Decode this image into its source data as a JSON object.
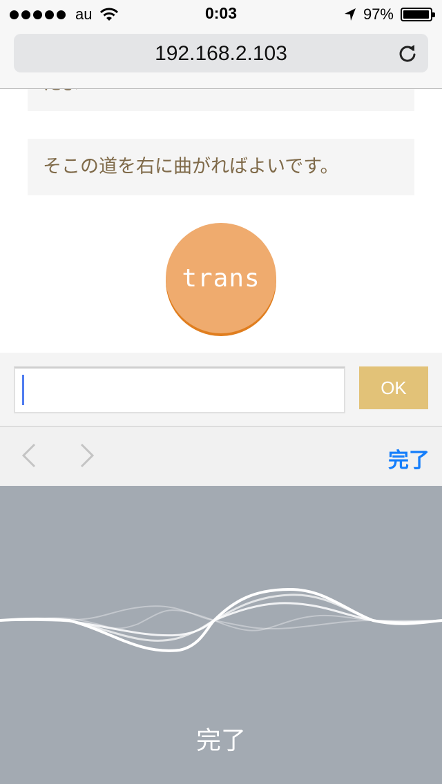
{
  "status_bar": {
    "carrier": "au",
    "time": "0:03",
    "battery_percent_text": "97%",
    "battery_level": 0.97,
    "icons": [
      "signal-dots",
      "wifi-icon",
      "location-arrow-icon",
      "battery-icon"
    ]
  },
  "address_bar": {
    "url": "192.168.2.103",
    "reload_icon": "reload-icon"
  },
  "content": {
    "previous_message": "たよ",
    "message": "そこの道を右に曲がればよいです。",
    "trans_button_label": "trans"
  },
  "input_row": {
    "value": "",
    "ok_label": "OK"
  },
  "keyboard_accessory": {
    "prev_icon": "chevron-left-icon",
    "next_icon": "chevron-right-icon",
    "done_label": "完了"
  },
  "dictation": {
    "done_label": "完了",
    "icon": "waveform-icon"
  },
  "colors": {
    "accent_blue": "#157efb",
    "trans_button": "#efab6e",
    "trans_button_shadow": "#e07e1f",
    "ok_button": "#e2c278",
    "message_text": "#7f6a49",
    "dictation_bg": "#a3aab2"
  }
}
